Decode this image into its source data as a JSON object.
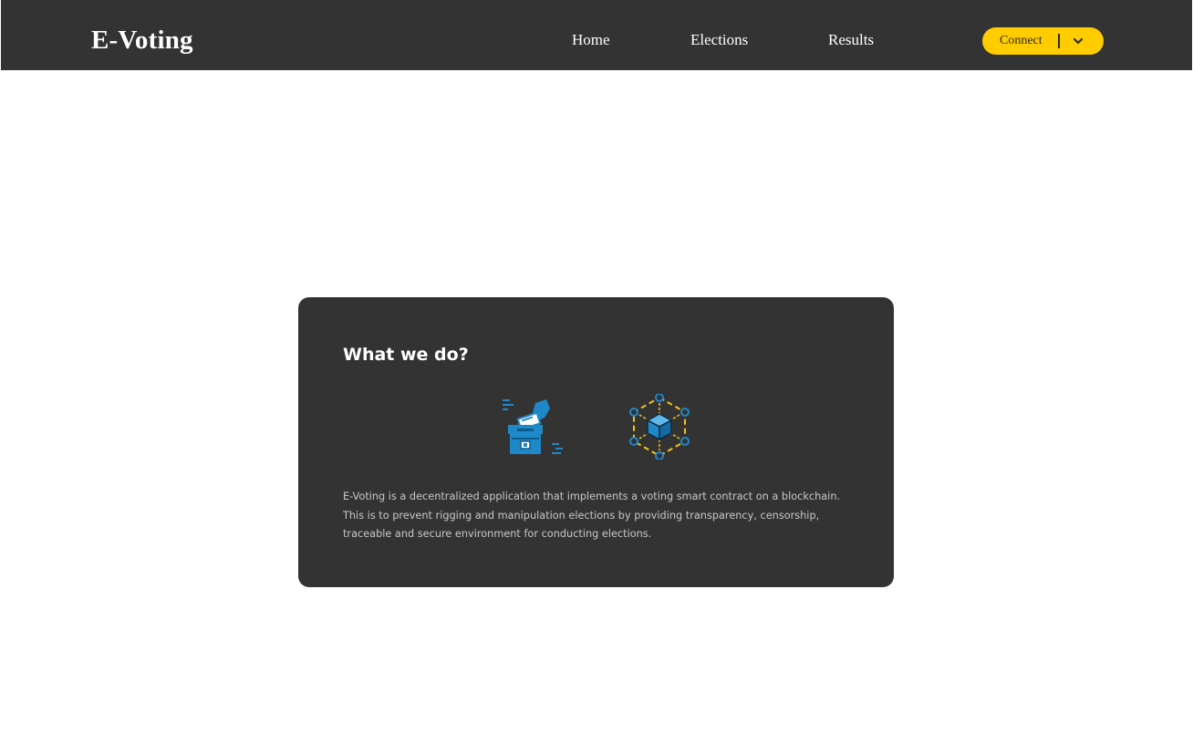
{
  "header": {
    "brand": "E-Voting",
    "nav": [
      {
        "label": "Home"
      },
      {
        "label": "Elections"
      },
      {
        "label": "Results"
      }
    ],
    "connect_label": "Connect",
    "connect_dropdown_icon": "chevron-down-icon"
  },
  "main": {
    "card": {
      "title": "What we do?",
      "icons": [
        "ballot-box-icon",
        "blockchain-network-icon"
      ],
      "description_lines": [
        "E-Voting is a decentralized application that implements a voting smart contract on a blockchain.",
        "This is to prevent rigging and manipulation elections by providing transparency, censorship,",
        "traceable and secure environment for conducting elections."
      ]
    }
  },
  "colors": {
    "navbar_bg": "#333333",
    "card_bg": "#333333",
    "accent": "#ffcc00",
    "icon_blue": "#1e88c8",
    "page_bg": "#ffffff"
  }
}
